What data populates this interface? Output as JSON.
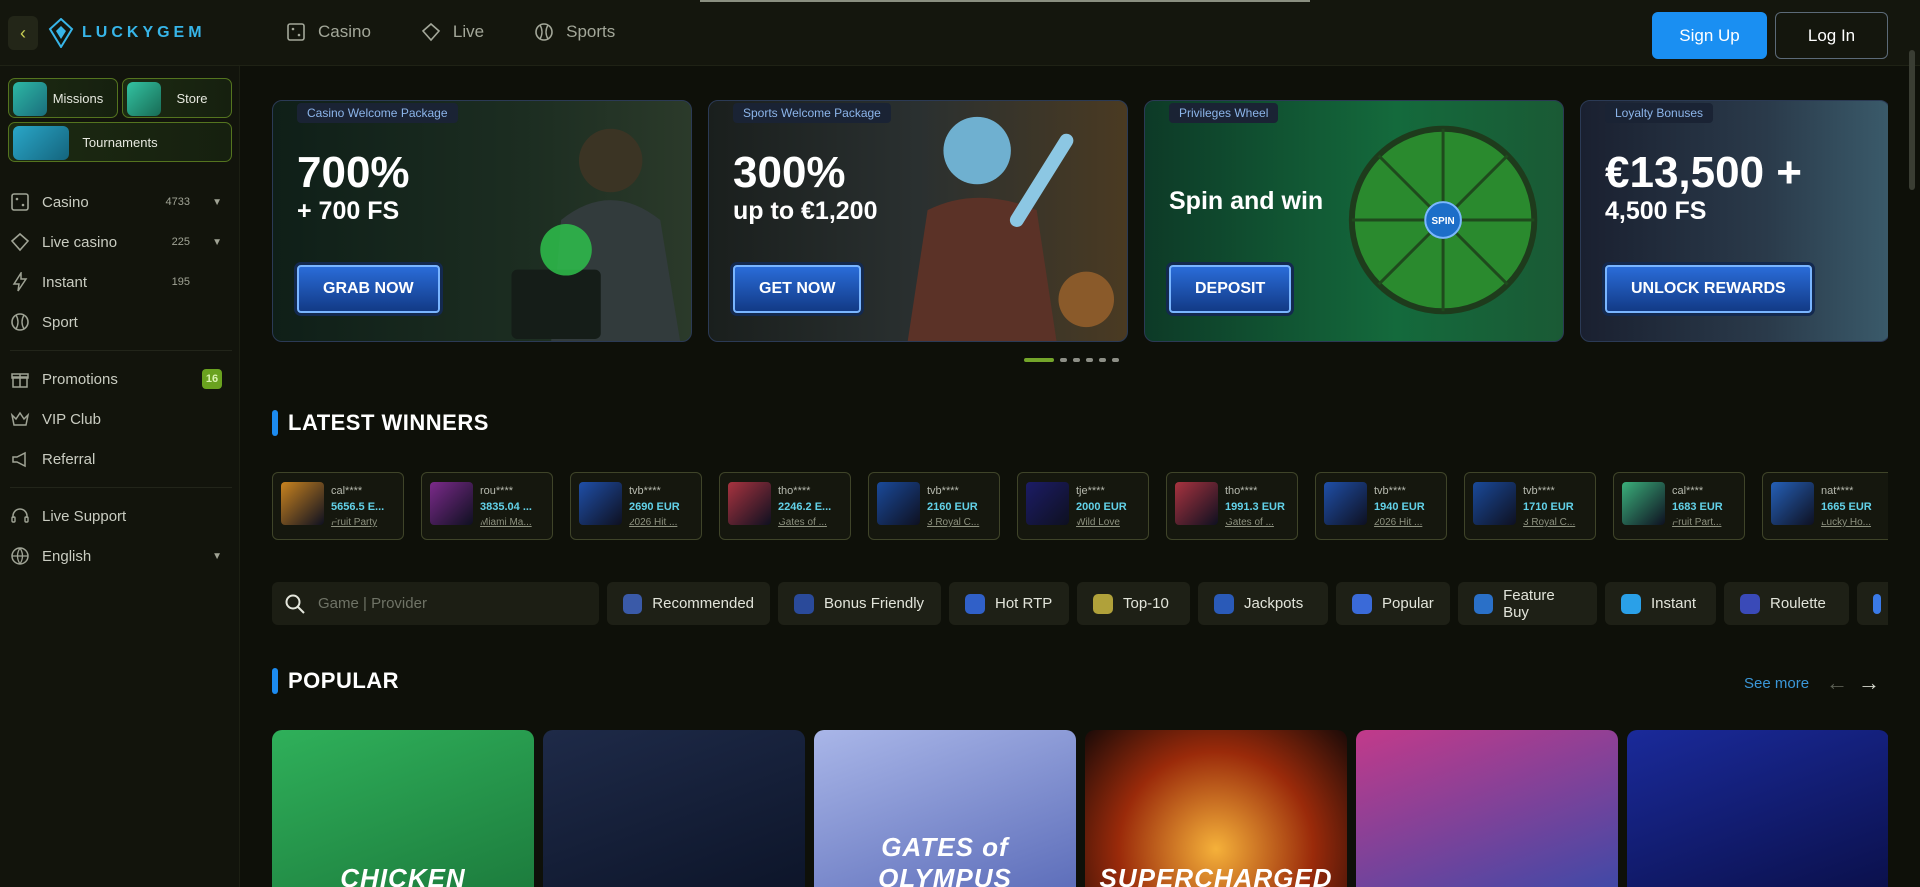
{
  "brand": {
    "name": "LUCKYGEM",
    "accent": "#37b5e8"
  },
  "topnav": [
    {
      "label": "Casino",
      "icon": "casino-icon"
    },
    {
      "label": "Live",
      "icon": "live-icon"
    },
    {
      "label": "Sports",
      "icon": "sports-ball-icon"
    }
  ],
  "auth": {
    "signup": "Sign Up",
    "login": "Log In"
  },
  "sidebar": {
    "chips": {
      "missions": "Missions",
      "store": "Store",
      "tournaments": "Tournaments"
    },
    "items": [
      {
        "label": "Casino",
        "count": "4733",
        "chevron": true,
        "icon": "casino-icon"
      },
      {
        "label": "Live casino",
        "count": "225",
        "chevron": true,
        "icon": "live-casino-icon"
      },
      {
        "label": "Instant",
        "count": "195",
        "chevron": false,
        "icon": "lightning-icon"
      },
      {
        "label": "Sport",
        "count": "",
        "chevron": false,
        "icon": "sports-ball-icon"
      }
    ],
    "items2": [
      {
        "label": "Promotions",
        "badge": "16",
        "icon": "gift-icon"
      },
      {
        "label": "VIP Club",
        "icon": "crown-icon"
      },
      {
        "label": "Referral",
        "icon": "megaphone-icon"
      }
    ],
    "items3": [
      {
        "label": "Live Support",
        "icon": "headset-icon"
      },
      {
        "label": "English",
        "icon": "globe-icon",
        "chevron": true
      }
    ]
  },
  "banners": [
    {
      "tag": "Casino Welcome Package",
      "big": "700%",
      "small": "+ 700 FS",
      "cta": "GRAB NOW"
    },
    {
      "tag": "Sports Welcome Package",
      "big": "300%",
      "small": "up to €1,200",
      "cta": "GET NOW"
    },
    {
      "tag": "Privileges Wheel",
      "big": "Spin and win",
      "small": "",
      "cta": "DEPOSIT",
      "wheel_center": "SPIN"
    },
    {
      "tag": "Loyalty Bonuses",
      "big": "€13,500 +",
      "small": "4,500 FS",
      "cta": "UNLOCK REWARDS"
    }
  ],
  "carousel": {
    "total": 6,
    "active": 1
  },
  "latest_winners": {
    "title": "LATEST WINNERS",
    "items": [
      {
        "user": "cal****",
        "amount": "5656.5 E...",
        "game": "Fruit Party"
      },
      {
        "user": "rou****",
        "amount": "3835.04 ...",
        "game": "Miami Ma..."
      },
      {
        "user": "tvb****",
        "amount": "2690 EUR",
        "game": "2026 Hit ..."
      },
      {
        "user": "tho****",
        "amount": "2246.2 E...",
        "game": "Gates of ..."
      },
      {
        "user": "tvb****",
        "amount": "2160 EUR",
        "game": "3 Royal C..."
      },
      {
        "user": "tje****",
        "amount": "2000 EUR",
        "game": "Wild Love"
      },
      {
        "user": "tho****",
        "amount": "1991.3 EUR",
        "game": "Gates of ..."
      },
      {
        "user": "tvb****",
        "amount": "1940 EUR",
        "game": "2026 Hit ..."
      },
      {
        "user": "tvb****",
        "amount": "1710 EUR",
        "game": "3 Royal C..."
      },
      {
        "user": "cal****",
        "amount": "1683 EUR",
        "game": "Fruit Part..."
      },
      {
        "user": "nat****",
        "amount": "1665 EUR",
        "game": "Lucky Ho..."
      }
    ]
  },
  "search": {
    "placeholder": "Game | Provider"
  },
  "filters": [
    "Recommended",
    "Bonus Friendly",
    "Hot RTP",
    "Top-10",
    "Jackpots",
    "Popular",
    "Feature Buy",
    "Instant",
    "Roulette",
    ""
  ],
  "popular": {
    "title": "POPULAR",
    "see_more": "See more",
    "games": [
      "CHICKEN",
      "",
      "GATES of OLYMPUS",
      "SUPERCHARGED",
      "",
      ""
    ]
  }
}
